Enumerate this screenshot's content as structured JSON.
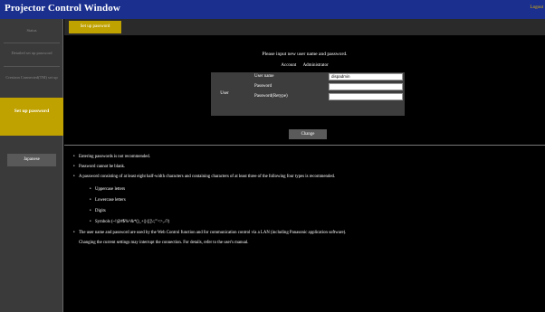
{
  "header": {
    "title": "Projector Control Window",
    "logout_label": "Logout"
  },
  "sidebar": {
    "items": [
      {
        "label": "Status"
      },
      {
        "label": "Detailed set up password"
      },
      {
        "label": "Crestron Connected(TM) set up"
      },
      {
        "label": "Set up password"
      }
    ],
    "language_label": "Japanese"
  },
  "tabs": {
    "active_label": "Set up password"
  },
  "form": {
    "prompt": "Please input new user name and password.",
    "account_label": "Account",
    "account_value": "Administrator",
    "user_label": "User",
    "fields": [
      {
        "label": "User name",
        "value": "dispadmin"
      },
      {
        "label": "Password",
        "value": ""
      },
      {
        "label": "Password(Retype)",
        "value": ""
      }
    ],
    "change_label": "Change"
  },
  "notes": {
    "n1": "Entering passwords is not recommended.",
    "n2": "Password cannot be blank.",
    "n3": "A password consisting of at least eight half-width characters and containing characters of at least three of the following four types is recommended.",
    "s1": "Uppercase letters",
    "s2": "Lowercase letters",
    "s3": "Digits",
    "s4": "Symbols (~!@#$%^&*()_+|}{[]\\:;\"'<>,./?)",
    "n4": "The user name and password are used by the Web Control function and for communication control via a LAN (including Panasonic application software).",
    "n5": "Changing the current settings may interrupt the connection. For details, refer to the user's manual."
  }
}
